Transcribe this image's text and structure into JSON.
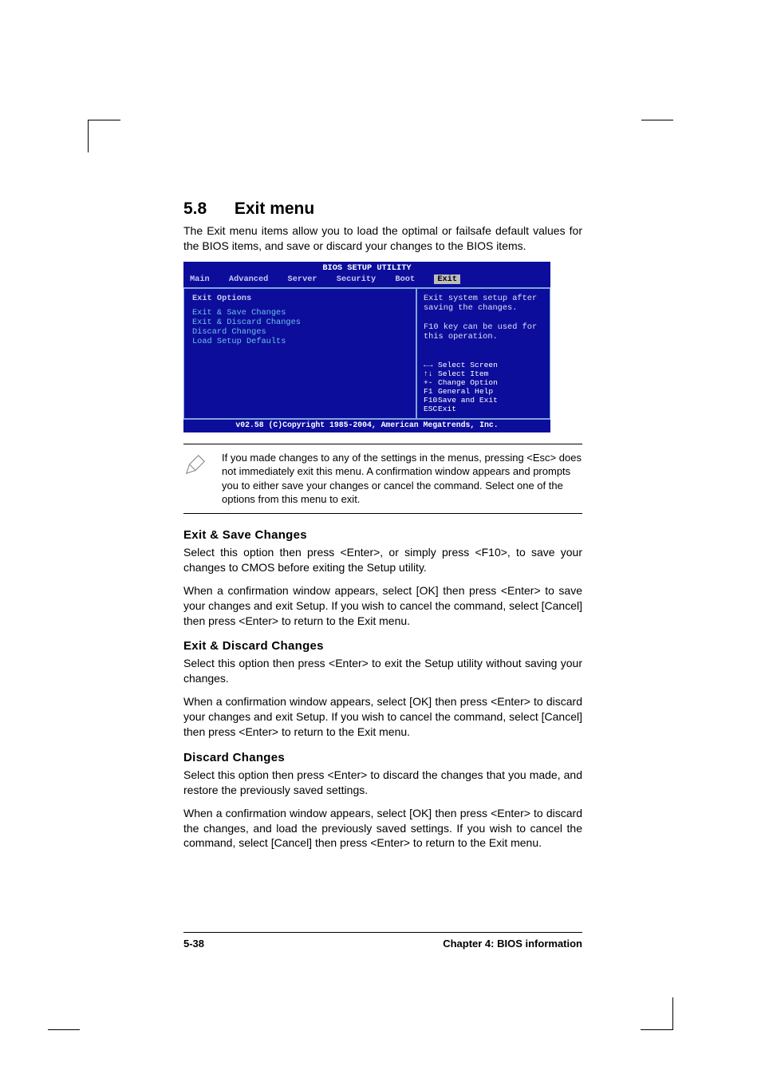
{
  "section": {
    "number": "5.8",
    "title": "Exit menu"
  },
  "intro": "The Exit menu items allow you to load the optimal or failsafe default values for the BIOS items, and save or discard your changes to the BIOS items.",
  "bios": {
    "title": "BIOS SETUP UTILITY",
    "tabs": [
      "Main",
      "Advanced",
      "Server",
      "Security",
      "Boot",
      "Exit"
    ],
    "active_tab": "Exit",
    "left_header": "Exit Options",
    "left_items": [
      "Exit & Save Changes",
      "Exit & Discard Changes",
      "Discard Changes",
      "",
      "Load Setup Defaults"
    ],
    "help_top": "Exit system setup after saving the changes.\n\nF10 key can be used for this operation.",
    "keys": [
      {
        "sym": "←→",
        "label": "Select Screen"
      },
      {
        "sym": "↑↓",
        "label": "Select Item"
      },
      {
        "sym": "+-",
        "label": "Change Option"
      },
      {
        "sym": "F1",
        "label": "General Help"
      },
      {
        "sym": "F10",
        "label": "Save and Exit"
      },
      {
        "sym": "ESC",
        "label": "Exit"
      }
    ],
    "footer": "v02.58 (C)Copyright 1985-2004, American Megatrends, Inc."
  },
  "note": "If you made changes to any of the settings in the menus, pressing <Esc> does not immediately exit this menu. A confirmation window appears and prompts you to either save your changes or cancel the command. Select one of the options from this menu to exit.",
  "sections": {
    "ess": {
      "heading": "Exit & Save Changes",
      "p1": "Select this option then press <Enter>, or simply press <F10>, to save your changes to CMOS before exiting the Setup utility.",
      "p2": "When a confirmation window appears, select [OK] then press <Enter> to save your changes and exit Setup. If you wish to cancel the command, select [Cancel] then press <Enter> to return to the Exit menu."
    },
    "edc": {
      "heading": "Exit & Discard Changes",
      "p1": "Select this option then press <Enter> to exit the Setup utility without saving your changes.",
      "p2": "When a confirmation window appears, select [OK] then press <Enter> to discard your changes and exit Setup. If you wish to cancel the command, select [Cancel] then press <Enter> to return to the Exit menu."
    },
    "dc": {
      "heading": "Discard Changes",
      "p1": "Select this option then press <Enter> to discard the changes that you made, and restore the previously saved settings.",
      "p2": "When a confirmation window appears, select [OK] then press <Enter> to discard the changes, and load the previously saved settings. If you wish to cancel the command, select [Cancel] then press <Enter> to return to the Exit menu."
    }
  },
  "footer": {
    "left": "5-38",
    "right": "Chapter 4: BIOS information"
  }
}
